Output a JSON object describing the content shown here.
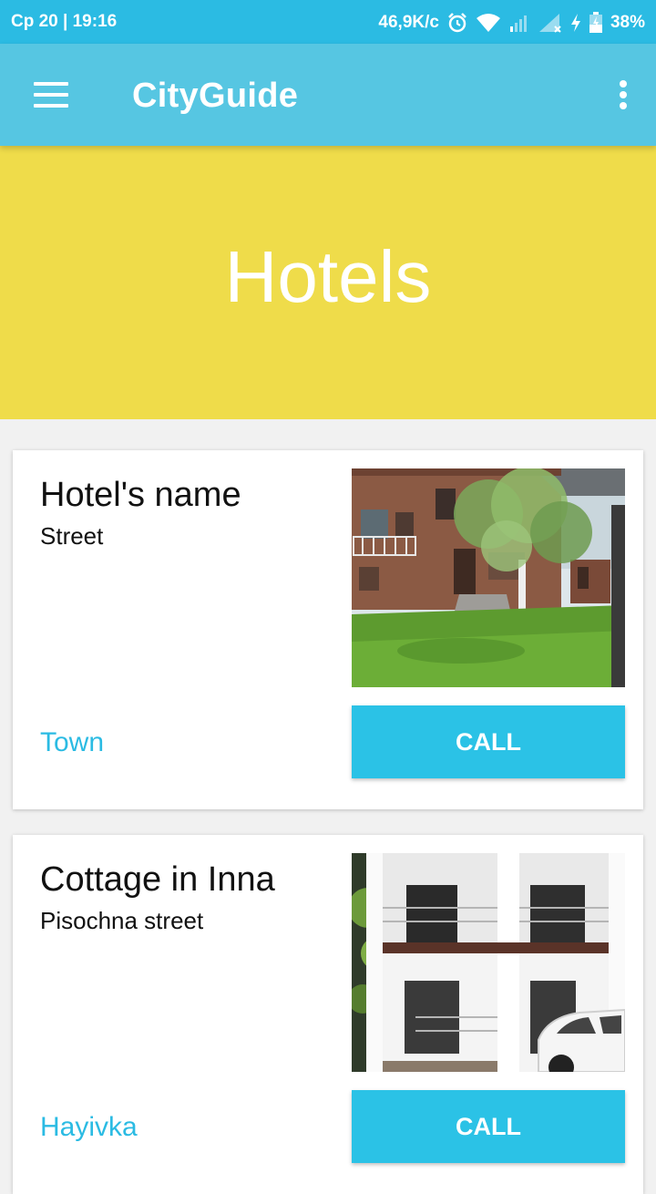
{
  "status_bar": {
    "left_text": "Ср 20 | 19:16",
    "net_speed": "46,9K/c",
    "battery": "38%",
    "icons": [
      "alarm-icon",
      "wifi-icon",
      "signal-icon",
      "signal-off-icon",
      "charging-icon",
      "battery-icon"
    ]
  },
  "app_bar": {
    "title": "CityGuide",
    "menu_icon": "hamburger-menu-icon",
    "overflow_icon": "more-vert-icon"
  },
  "hero": {
    "title": "Hotels",
    "background": "#efdc4a"
  },
  "hotels": [
    {
      "name": "Hotel's name",
      "street": "Street",
      "town": "Town",
      "call_label": "CALL"
    },
    {
      "name": "Cottage in Inna",
      "street": "Pisochna street",
      "town": "Hayivka",
      "call_label": "CALL"
    }
  ],
  "colors": {
    "status_bar": "#2bbbe3",
    "app_bar": "#56c6e2",
    "accent": "#2bc2e6",
    "link": "#2bbbe3"
  }
}
